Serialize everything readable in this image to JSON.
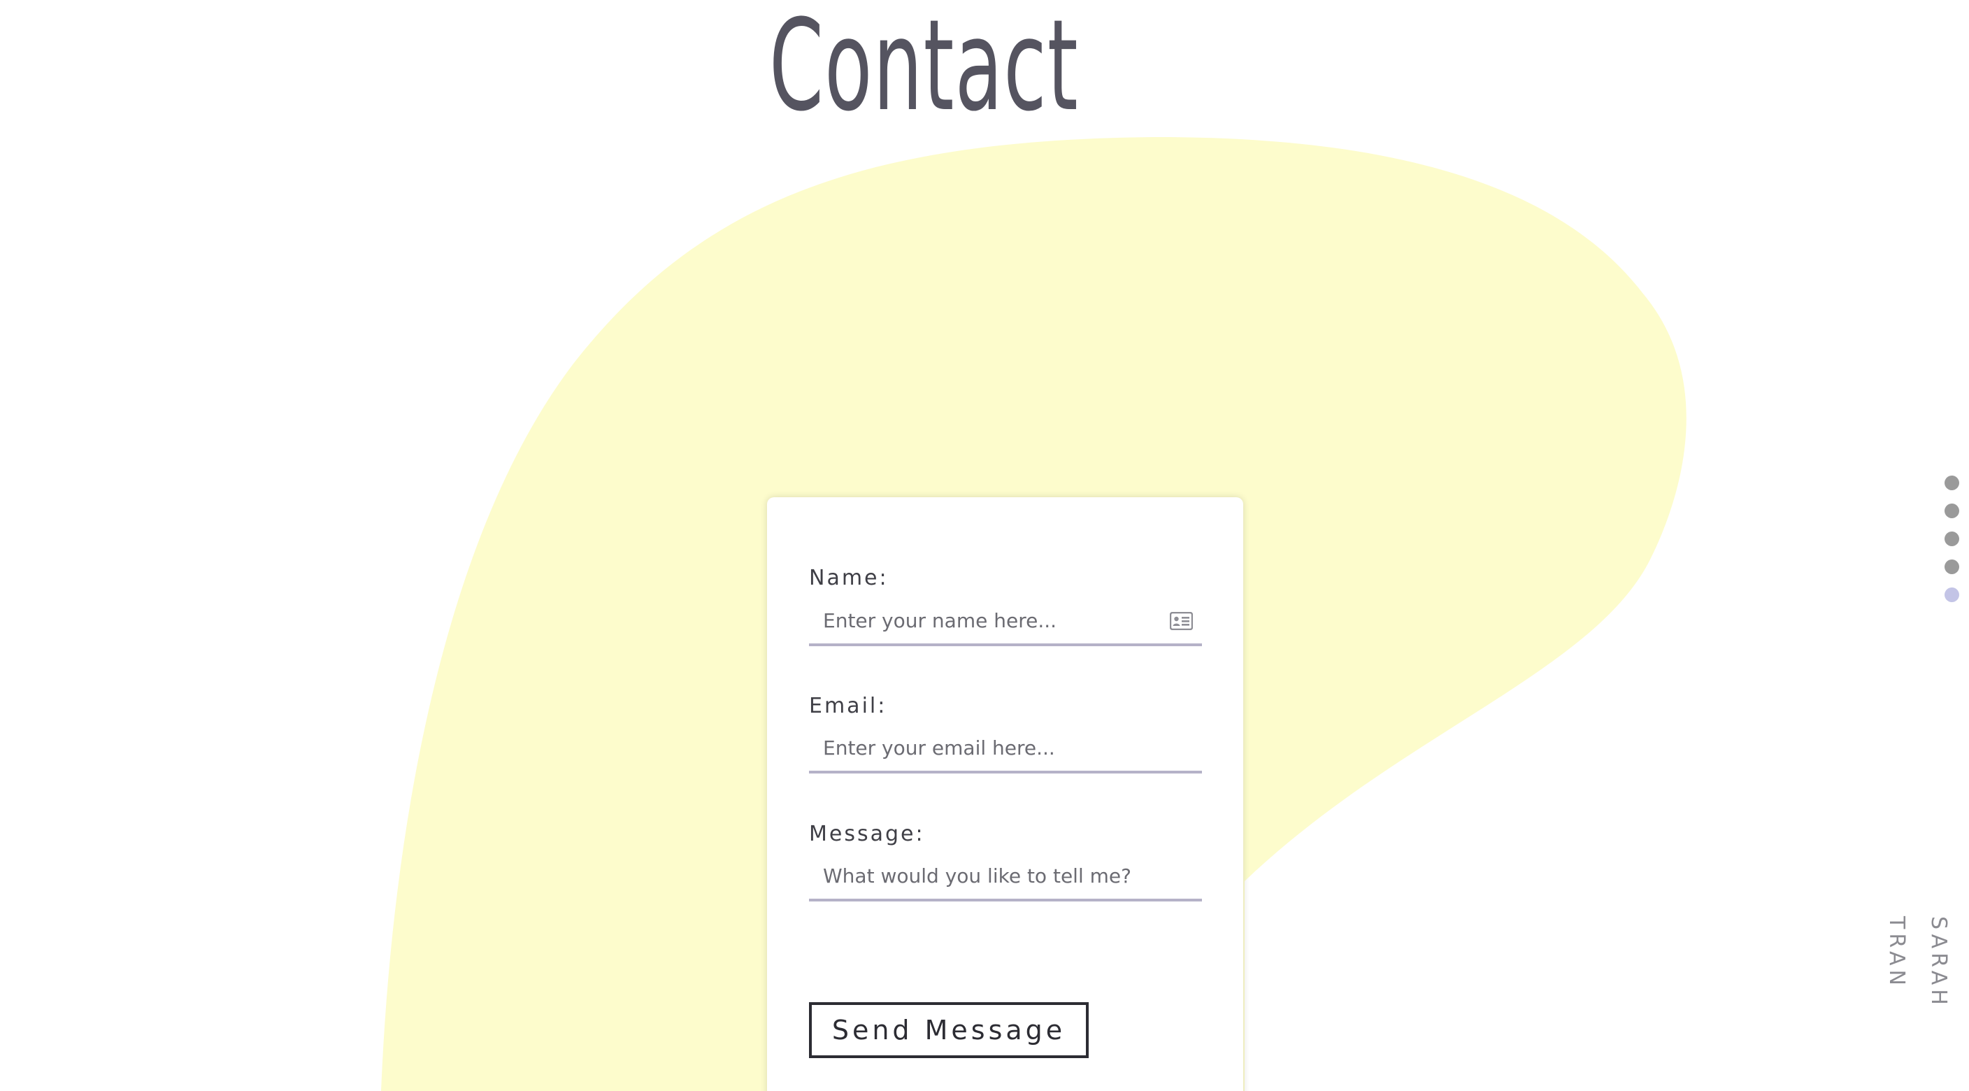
{
  "page": {
    "title": "Contact",
    "author": "SARAH TRAN"
  },
  "form": {
    "name_label": "Name:",
    "name_placeholder": "Enter your name here...",
    "email_label": "Email:",
    "email_placeholder": "Enter your email here...",
    "message_label": "Message:",
    "message_placeholder": "What would you like to tell me?",
    "send_label": "Send Message"
  },
  "icons": {
    "name_field": "contact-card-icon"
  },
  "nav": {
    "section_count": 5,
    "active_index": 4
  },
  "colors": {
    "blob": "#fdfccc",
    "title": "#555460",
    "input_underline": "#b5b2c8",
    "dot_inactive": "#9a9a9a",
    "dot_active": "#c3c4e6",
    "button_border": "#2c2c33"
  }
}
